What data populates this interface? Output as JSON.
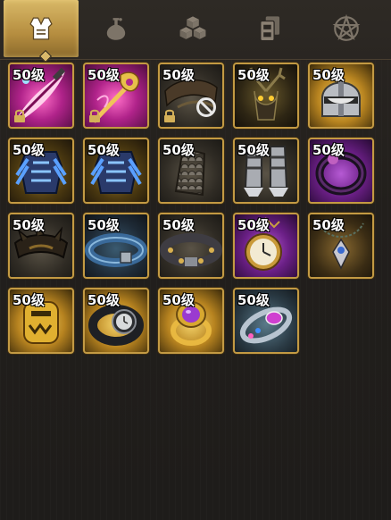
{
  "tabs": [
    {
      "name": "tab-equipment",
      "icon": "armor-vest-icon",
      "active": true
    },
    {
      "name": "tab-potions",
      "icon": "potion-flask-icon",
      "active": false
    },
    {
      "name": "tab-materials",
      "icon": "cubes-icon",
      "active": false
    },
    {
      "name": "tab-cards",
      "icon": "cards-icon",
      "active": false
    },
    {
      "name": "tab-special",
      "icon": "pentagram-icon",
      "active": false
    }
  ],
  "items": [
    {
      "level": "50级",
      "icon": "feather-dagger-icon",
      "quality": "pink",
      "locked": true,
      "disabled": false
    },
    {
      "level": "50级",
      "icon": "staff-scepter-icon",
      "quality": "pink",
      "locked": true,
      "disabled": false
    },
    {
      "level": "50级",
      "icon": "leather-wrap-icon",
      "quality": "dark",
      "locked": true,
      "disabled": true
    },
    {
      "level": "50级",
      "icon": "antler-mask-icon",
      "quality": "gold",
      "locked": false,
      "disabled": false
    },
    {
      "level": "50级",
      "icon": "knight-helmet-icon",
      "quality": "gold",
      "locked": false,
      "disabled": false
    },
    {
      "level": "50级",
      "icon": "blue-cuirass-icon",
      "quality": "gold",
      "locked": false,
      "disabled": false
    },
    {
      "level": "50级",
      "icon": "blue-cuirass-icon",
      "quality": "gold",
      "locked": false,
      "disabled": false
    },
    {
      "level": "50级",
      "icon": "scale-bracer-icon",
      "quality": "dark",
      "locked": false,
      "disabled": false
    },
    {
      "level": "50级",
      "icon": "plate-greaves-icon",
      "quality": "dark",
      "locked": false,
      "disabled": false
    },
    {
      "level": "50级",
      "icon": "purple-ring-icon",
      "quality": "purple",
      "locked": false,
      "disabled": false
    },
    {
      "level": "50级",
      "icon": "spiked-collar-icon",
      "quality": "dark",
      "locked": false,
      "disabled": false
    },
    {
      "level": "50级",
      "icon": "blue-belt-icon",
      "quality": "dark",
      "locked": false,
      "disabled": false
    },
    {
      "level": "50级",
      "icon": "studded-belt-icon",
      "quality": "dark",
      "locked": false,
      "disabled": false
    },
    {
      "level": "50级",
      "icon": "pocket-watch-icon",
      "quality": "purple",
      "locked": false,
      "disabled": false
    },
    {
      "level": "50级",
      "icon": "pendant-necklace-icon",
      "quality": "gold",
      "locked": false,
      "disabled": false
    },
    {
      "level": "50级",
      "icon": "golden-idol-icon",
      "quality": "gold",
      "locked": false,
      "disabled": false
    },
    {
      "level": "50级",
      "icon": "wristwatch-icon",
      "quality": "gold",
      "locked": false,
      "disabled": false
    },
    {
      "level": "50级",
      "icon": "amethyst-ring-icon",
      "quality": "gold",
      "locked": false,
      "disabled": false
    },
    {
      "level": "50级",
      "icon": "gem-bracelet-icon",
      "quality": "gold",
      "locked": false,
      "disabled": false
    }
  ],
  "colors": {
    "frame_gold": "#c39a43",
    "tab_active": "#c9a455",
    "background": "#242120"
  }
}
